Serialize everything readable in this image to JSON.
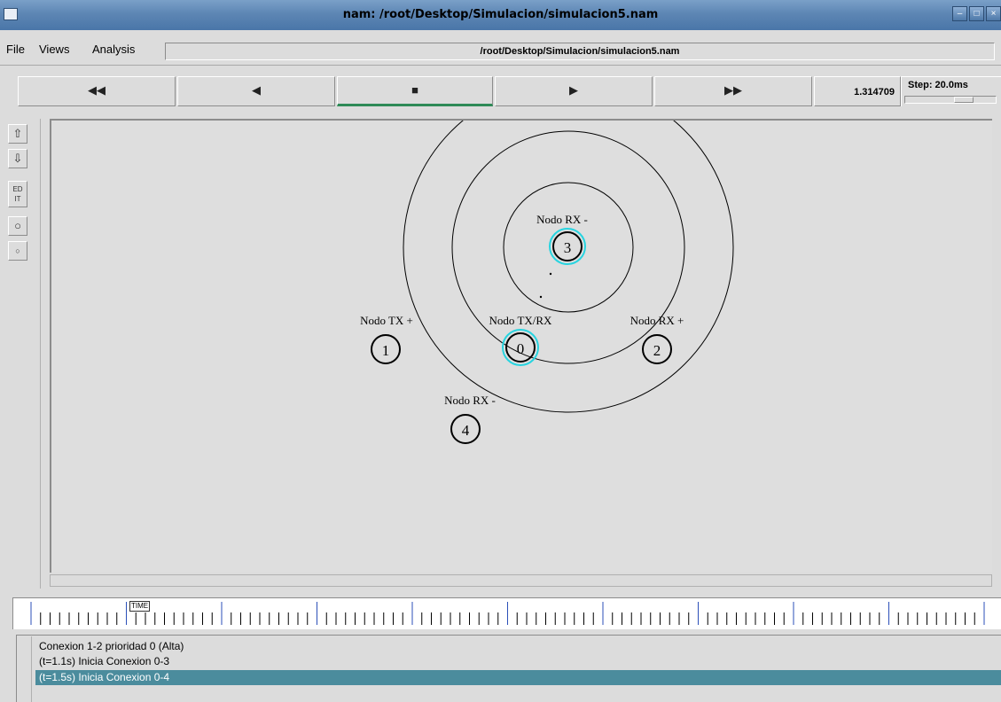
{
  "window": {
    "title": "nam: /root/Desktop/Simulacion/simulacion5.nam"
  },
  "menubar": {
    "file_label": "File",
    "views_label": "Views",
    "analysis_label": "Analysis",
    "filepath": "/root/Desktop/Simulacion/simulacion5.nam"
  },
  "controls": {
    "rewind_icon": "◀◀",
    "back_icon": "◀",
    "stop_icon": "■",
    "play_icon": "▶",
    "fastforward_icon": "▶▶",
    "time": "1.314709",
    "step_label": "Step: 20.0ms"
  },
  "toolbar": {
    "edit_label_1": "ED",
    "edit_label_2": "IT"
  },
  "nodes": [
    {
      "id": "0",
      "label": "Nodo TX/RX",
      "highlighted": true
    },
    {
      "id": "1",
      "label": "Nodo TX +",
      "highlighted": false
    },
    {
      "id": "2",
      "label": "Nodo RX +",
      "highlighted": false
    },
    {
      "id": "3",
      "label": "Nodo RX -",
      "highlighted": true
    },
    {
      "id": "4",
      "label": "Nodo RX -",
      "highlighted": false
    }
  ],
  "timeline": {
    "marker_label": "TIME"
  },
  "annotations": [
    {
      "text": "Conexion 1-2 prioridad 0 (Alta)",
      "selected": false
    },
    {
      "text": "(t=1.1s) Inicia Conexion 0-3",
      "selected": false
    },
    {
      "text": "(t=1.5s) Inicia Conexion 0-4",
      "selected": true
    }
  ],
  "colors": {
    "titlebar": "#5d86b4",
    "highlight_ring": "#27d4e0",
    "play_active": "#2e8a57",
    "annotation_selected": "#4b8c9d"
  }
}
